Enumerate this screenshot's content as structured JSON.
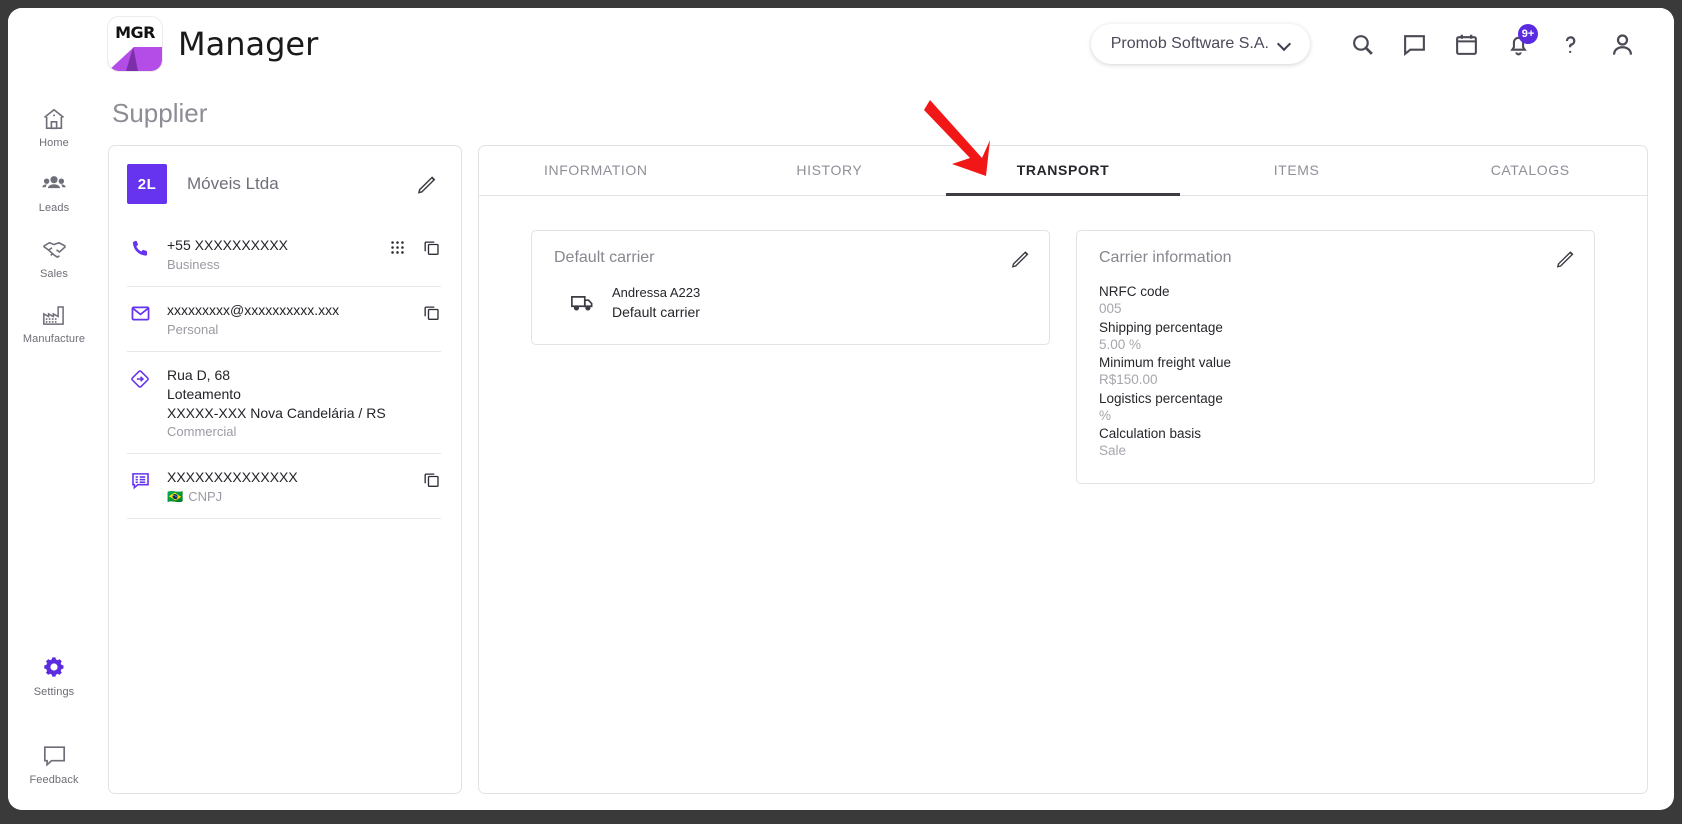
{
  "header": {
    "logo_text": "MGR",
    "app_title": "Manager",
    "org_selector": "Promob Software S.A.",
    "icons": [
      {
        "name": "search-icon",
        "label": "Search"
      },
      {
        "name": "chat-icon",
        "label": "Messages"
      },
      {
        "name": "calendar-icon",
        "label": "Calendar"
      },
      {
        "name": "bell-icon",
        "label": "Notifications"
      },
      {
        "name": "help-icon",
        "label": "Help"
      },
      {
        "name": "profile-icon",
        "label": "Profile"
      }
    ],
    "notification_badge": "9+",
    "help_glyph": "?"
  },
  "sidebar": {
    "items": [
      {
        "label": "Home",
        "icon": "home-icon",
        "active": false
      },
      {
        "label": "Leads",
        "icon": "leads-icon",
        "active": false
      },
      {
        "label": "Sales",
        "icon": "handshake-icon",
        "active": false
      },
      {
        "label": "Manufacture",
        "icon": "factory-icon",
        "active": false
      }
    ],
    "bottom_items": [
      {
        "label": "Settings",
        "icon": "gear-icon",
        "active": true
      },
      {
        "label": "Feedback",
        "icon": "speech-bubble-icon",
        "active": false
      }
    ]
  },
  "page": {
    "title": "Supplier"
  },
  "supplier": {
    "avatar_initials": "2L",
    "name": "Móveis Ltda",
    "rows": [
      {
        "icon": "phone-icon",
        "main": "+55 XXXXXXXXXX",
        "sub": "Business",
        "flag": "",
        "actions": [
          "dialpad-icon",
          "copy-icon"
        ]
      },
      {
        "icon": "email-icon",
        "main": "xxxxxxxxx@xxxxxxxxxx.xxx",
        "sub": "Personal",
        "flag": "",
        "actions": [
          "copy-icon"
        ]
      },
      {
        "icon": "location-icon",
        "main": "Rua D, 68\nLoteamento\nXXXXX-XXX Nova Candelária / RS",
        "sub": "Commercial",
        "flag": "",
        "actions": []
      },
      {
        "icon": "document-icon",
        "main": "XXXXXXXXXXXXXX",
        "sub": "CNPJ",
        "flag": "🇧🇷",
        "actions": [
          "copy-icon"
        ]
      }
    ]
  },
  "tabs": [
    {
      "label": "INFORMATION",
      "active": false
    },
    {
      "label": "HISTORY",
      "active": false
    },
    {
      "label": "TRANSPORT",
      "active": true
    },
    {
      "label": "ITEMS",
      "active": false
    },
    {
      "label": "CATALOGS",
      "active": false
    }
  ],
  "default_carrier_card": {
    "title": "Default carrier",
    "carrier_name": "Andressa A223",
    "carrier_role": "Default carrier"
  },
  "carrier_information_card": {
    "title": "Carrier information",
    "fields": [
      {
        "label": "NRFC code",
        "value": "005"
      },
      {
        "label": "Shipping percentage",
        "value": "5.00 %"
      },
      {
        "label": "Minimum freight value",
        "value": "R$150.00"
      },
      {
        "label": "Logistics percentage",
        "value": "%"
      },
      {
        "label": "Calculation basis",
        "value": "Sale"
      }
    ]
  },
  "annotation": {
    "arrow_color": "#f21717"
  },
  "colors": {
    "accent_purple": "#5b2be0",
    "avatar_purple": "#6633ee",
    "logo_magenta": "#b44ce8"
  }
}
